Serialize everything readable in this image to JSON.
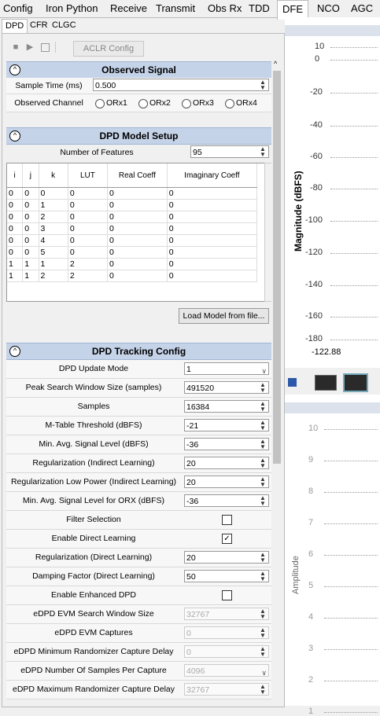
{
  "top_tabs": [
    "Config",
    "Iron Python",
    "Receive",
    "Transmit",
    "Obs Rx",
    "TDD",
    "DFE",
    "NCO",
    "AGC"
  ],
  "sub_tabs": [
    "DPD",
    "CFR",
    "CLGC"
  ],
  "toolbar": {
    "aclr_label": "ACLR Config"
  },
  "observed_signal": {
    "title": "Observed Signal",
    "sample_time_label": "Sample Time (ms)",
    "sample_time_value": "0.500",
    "observed_channel_label": "Observed Channel",
    "channels": [
      "ORx1",
      "ORx2",
      "ORx3",
      "ORx4"
    ]
  },
  "model_setup": {
    "title": "DPD Model Setup",
    "num_features_label": "Number of Features",
    "num_features_value": "95",
    "columns": [
      "i",
      "j",
      "k",
      "LUT",
      "Real Coeff",
      "Imaginary Coeff"
    ],
    "rows": [
      [
        "0",
        "0",
        "0",
        "0",
        "0",
        "0"
      ],
      [
        "0",
        "0",
        "1",
        "0",
        "0",
        "0"
      ],
      [
        "0",
        "0",
        "2",
        "0",
        "0",
        "0"
      ],
      [
        "0",
        "0",
        "3",
        "0",
        "0",
        "0"
      ],
      [
        "0",
        "0",
        "4",
        "0",
        "0",
        "0"
      ],
      [
        "0",
        "0",
        "5",
        "0",
        "0",
        "0"
      ],
      [
        "1",
        "1",
        "1",
        "2",
        "0",
        "0"
      ],
      [
        "1",
        "1",
        "2",
        "2",
        "0",
        "0"
      ]
    ],
    "load_button": "Load Model from file..."
  },
  "tracking": {
    "title": "DPD Tracking Config",
    "fields": [
      {
        "label": "DPD Update Mode",
        "value": "1",
        "kind": "dropdown"
      },
      {
        "label": "Peak Search Window Size (samples)",
        "value": "491520",
        "kind": "spin"
      },
      {
        "label": "Samples",
        "value": "16384",
        "kind": "spin"
      },
      {
        "label": "M-Table Threshold (dBFS)",
        "value": "-21",
        "kind": "spin"
      },
      {
        "label": "Min. Avg. Signal Level (dBFS)",
        "value": "-36",
        "kind": "spin"
      },
      {
        "label": "Regularization (Indirect Learning)",
        "value": "20",
        "kind": "spin"
      },
      {
        "label": "Regularization Low Power (Indirect Learning)",
        "value": "20",
        "kind": "spin"
      },
      {
        "label": "Min. Avg. Signal Level for ORX (dBFS)",
        "value": "-36",
        "kind": "spin"
      },
      {
        "label": "Filter Selection",
        "value": "",
        "kind": "check",
        "checked": false
      },
      {
        "label": "Enable Direct Learning",
        "value": "",
        "kind": "check",
        "checked": true
      },
      {
        "label": "Regularization (Direct Learning)",
        "value": "20",
        "kind": "spin"
      },
      {
        "label": "Damping Factor (Direct Learning)",
        "value": "50",
        "kind": "spin"
      },
      {
        "label": "Enable Enhanced DPD",
        "value": "",
        "kind": "check",
        "checked": false
      },
      {
        "label": "eDPD EVM Search Window Size",
        "value": "32767",
        "kind": "spin-dis"
      },
      {
        "label": "eDPD EVM Captures",
        "value": "0",
        "kind": "spin-dis"
      },
      {
        "label": "eDPD Minimum Randomizer Capture Delay",
        "value": "0",
        "kind": "spin-dis"
      },
      {
        "label": "eDPD Number Of Samples Per Capture",
        "value": "4096",
        "kind": "dropdown-dis"
      },
      {
        "label": "eDPD Maximum Randomizer Capture Delay",
        "value": "32767",
        "kind": "spin-dis"
      }
    ]
  },
  "plot1": {
    "ylabel": "Magnitude (dBFS)",
    "ticks": [
      "10",
      "0",
      "-20",
      "-40",
      "-60",
      "-80",
      "-100",
      "-120",
      "-140",
      "-160",
      "-180"
    ],
    "x_start": "-122.88"
  },
  "plot2": {
    "ylabel": "Amplitude",
    "ticks": [
      "10",
      "9",
      "8",
      "7",
      "6",
      "5",
      "4",
      "3",
      "2",
      "1"
    ]
  }
}
